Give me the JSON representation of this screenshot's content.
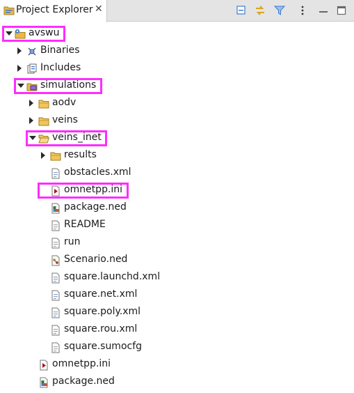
{
  "panel": {
    "title": "Project Explorer",
    "close_glyph": "✕",
    "toolbar": [
      {
        "icon": "collapse-all-icon"
      },
      {
        "icon": "link-with-editor-icon"
      },
      {
        "icon": "filter-icon"
      },
      {
        "icon": "view-menu-icon"
      },
      {
        "icon": "minimize-icon"
      },
      {
        "icon": "maximize-icon"
      }
    ]
  },
  "tree": {
    "items": [
      {
        "label": "avswu",
        "depth": 0,
        "state": "expanded",
        "icon": "project-folder-icon",
        "highlighted": true
      },
      {
        "label": "Binaries",
        "depth": 1,
        "state": "collapsed",
        "icon": "binaries-icon",
        "highlighted": false
      },
      {
        "label": "Includes",
        "depth": 1,
        "state": "collapsed",
        "icon": "includes-icon",
        "highlighted": false
      },
      {
        "label": "simulations",
        "depth": 1,
        "state": "expanded",
        "icon": "source-folder-icon",
        "highlighted": true
      },
      {
        "label": "aodv",
        "depth": 2,
        "state": "collapsed",
        "icon": "folder-icon",
        "highlighted": false
      },
      {
        "label": "veins",
        "depth": 2,
        "state": "collapsed",
        "icon": "folder-icon",
        "highlighted": false
      },
      {
        "label": "veins_inet",
        "depth": 2,
        "state": "expanded",
        "icon": "folder-open-icon",
        "highlighted": true
      },
      {
        "label": "results",
        "depth": 3,
        "state": "collapsed",
        "icon": "folder-icon",
        "highlighted": false
      },
      {
        "label": "obstacles.xml",
        "depth": 3,
        "state": "leaf",
        "icon": "xml-file-icon",
        "highlighted": false
      },
      {
        "label": "omnetpp.ini",
        "depth": 3,
        "state": "leaf",
        "icon": "ini-file-icon",
        "highlighted": true
      },
      {
        "label": "package.ned",
        "depth": 3,
        "state": "leaf",
        "icon": "ned-file-icon",
        "highlighted": false
      },
      {
        "label": "README",
        "depth": 3,
        "state": "leaf",
        "icon": "text-file-icon",
        "highlighted": false
      },
      {
        "label": "run",
        "depth": 3,
        "state": "leaf",
        "icon": "text-file-icon",
        "highlighted": false
      },
      {
        "label": "Scenario.ned",
        "depth": 3,
        "state": "leaf",
        "icon": "ned-network-file-icon",
        "highlighted": false
      },
      {
        "label": "square.launchd.xml",
        "depth": 3,
        "state": "leaf",
        "icon": "xml-file-icon",
        "highlighted": false
      },
      {
        "label": "square.net.xml",
        "depth": 3,
        "state": "leaf",
        "icon": "xml-file-icon",
        "highlighted": false
      },
      {
        "label": "square.poly.xml",
        "depth": 3,
        "state": "leaf",
        "icon": "xml-file-icon",
        "highlighted": false
      },
      {
        "label": "square.rou.xml",
        "depth": 3,
        "state": "leaf",
        "icon": "xml-file-icon",
        "highlighted": false
      },
      {
        "label": "square.sumocfg",
        "depth": 3,
        "state": "leaf",
        "icon": "text-file-icon",
        "highlighted": false
      },
      {
        "label": "omnetpp.ini",
        "depth": 2,
        "state": "leaf",
        "icon": "ini-file-icon",
        "highlighted": false
      },
      {
        "label": "package.ned",
        "depth": 2,
        "state": "leaf",
        "icon": "ned-file-icon",
        "highlighted": false
      }
    ]
  },
  "colors": {
    "highlight": "#ff2cff",
    "folder": "#e8b84a",
    "toolbar_blue": "#3d7bd0"
  }
}
